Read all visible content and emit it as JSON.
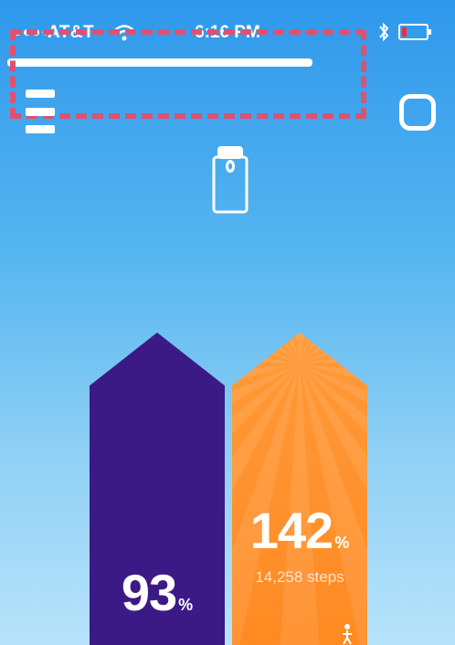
{
  "status_bar": {
    "carrier": "AT&T",
    "time": "6:16 PM",
    "signal_bars_filled": 3,
    "signal_bars_total": 5,
    "icons": [
      "signal-dots-icon",
      "wifi-icon",
      "bluetooth-icon",
      "battery-icon"
    ],
    "battery_color": "#e8323c"
  },
  "sync_progress": {
    "fraction": 1.0
  },
  "highlight": {
    "color": "#e0506f"
  },
  "header": {
    "left_icon": "menu-icon",
    "right_icon": "profile-icon",
    "center_icon": "device-icon"
  },
  "goals": [
    {
      "value": "93",
      "unit": "%",
      "subtitle": "",
      "color": "#3c1a86"
    },
    {
      "value": "142",
      "unit": "%",
      "subtitle": "14,258 steps",
      "color": "#ff8a22",
      "icon": "figure-icon"
    }
  ]
}
